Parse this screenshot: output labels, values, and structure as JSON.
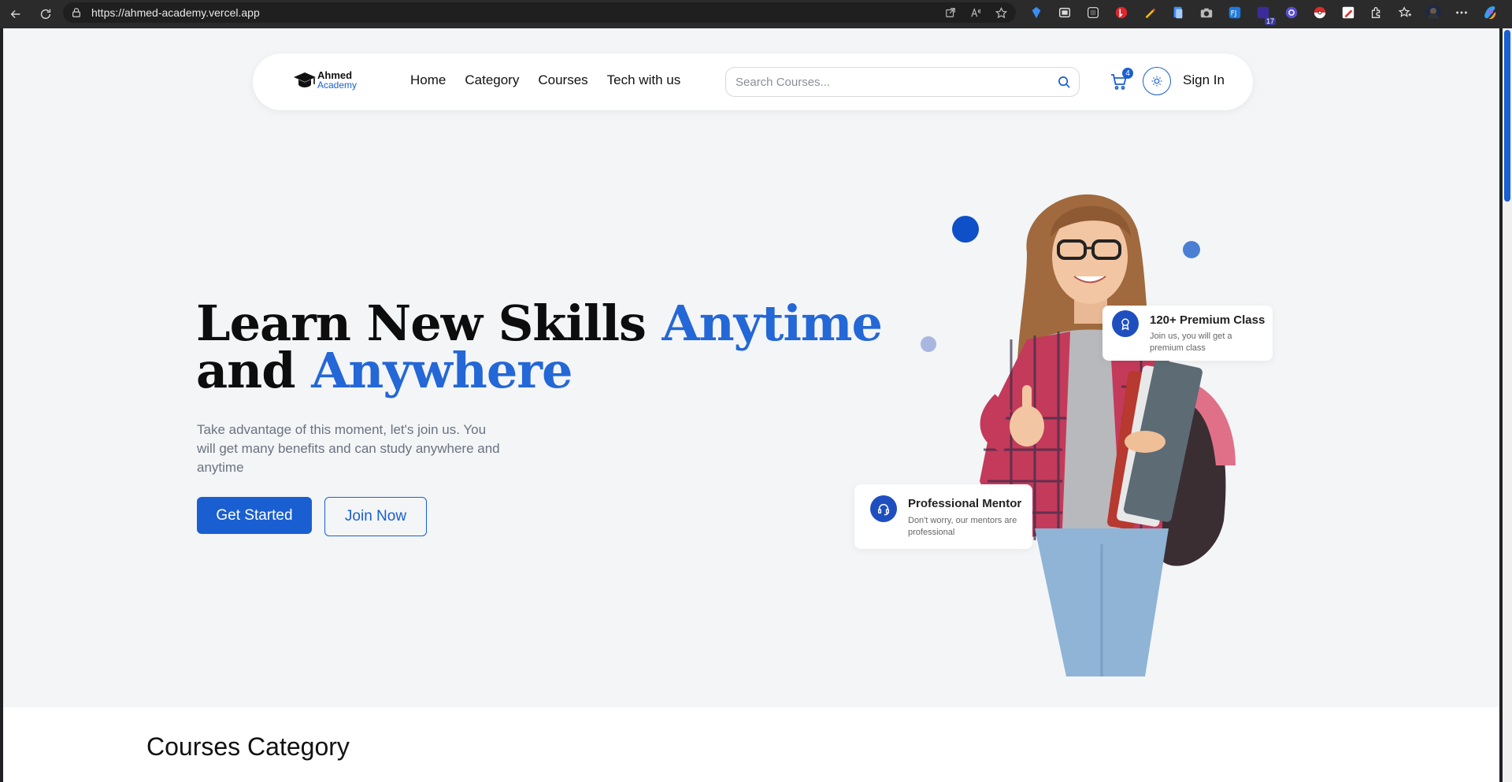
{
  "browser": {
    "url": "https://ahmed-academy.vercel.app",
    "extension_badge": "17"
  },
  "navbar": {
    "logo_line1": "Ahmed",
    "logo_line2": "Academy",
    "menu": [
      "Home",
      "Category",
      "Courses",
      "Tech with us"
    ],
    "search_placeholder": "Search Courses...",
    "cart_count": "4",
    "signin_label": "Sign In"
  },
  "hero": {
    "title_part1": "Learn New Skills ",
    "title_highlight1": "Anytime",
    "title_part2": "and ",
    "title_highlight2": "Anywhere",
    "subtitle": "Take advantage of this moment, let's join us. You will get many benefits and can study anywhere and anytime",
    "primary_button": "Get Started",
    "secondary_button": "Join Now"
  },
  "cards": {
    "premium_title": "120+ Premium Class",
    "premium_desc": "Join us, you will get a premium class",
    "mentor_title": "Professional Mentor",
    "mentor_desc": "Don't worry, our mentors are professional"
  },
  "section": {
    "category_title": "Courses Category"
  },
  "colors": {
    "accent": "#1a5fd1",
    "background": "#f3f5f7"
  }
}
